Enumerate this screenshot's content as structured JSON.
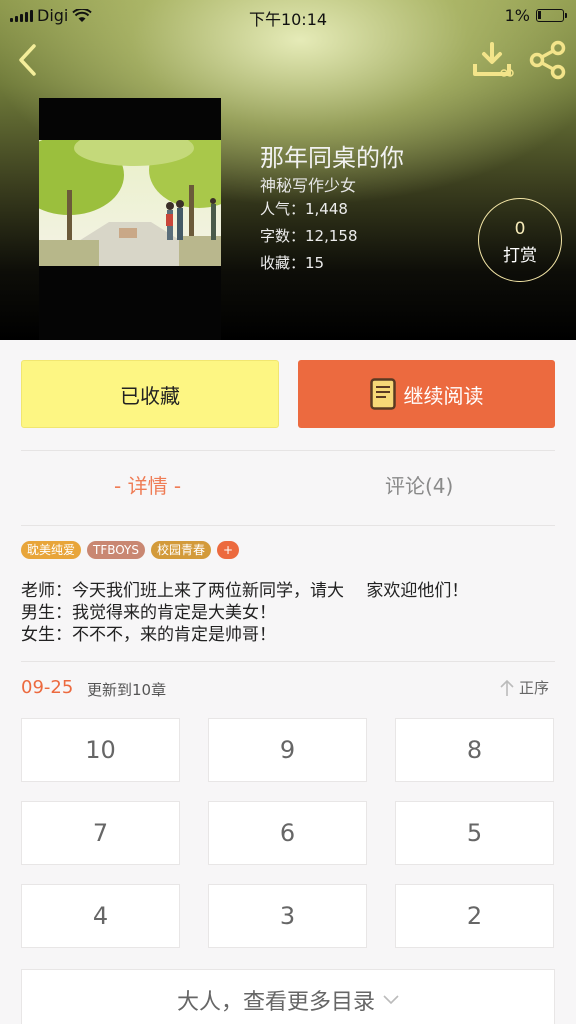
{
  "status_bar": {
    "carrier": "Digi",
    "time": "下午10:14",
    "battery": "1%"
  },
  "book": {
    "title": "那年同桌的你",
    "author": "神秘写作少女",
    "popularity": "人气：1,448",
    "word_count": "字数：12,158",
    "favorites": "收藏：15"
  },
  "tip": {
    "count": "0",
    "label": "打赏"
  },
  "actions": {
    "favorite_label": "已收藏",
    "read_label": "继续阅读"
  },
  "tabs": {
    "detail": "- 详情 -",
    "comments": "评论(4)"
  },
  "tags": [
    {
      "label": "耽美纯爱",
      "color": "#e8a53a"
    },
    {
      "label": "TFBOYS",
      "color": "#c98772"
    },
    {
      "label": "校园青春",
      "color": "#d39a3a"
    },
    {
      "label": "+",
      "color": "#ec6a3f"
    }
  ],
  "synopsis": [
    "老师：今天我们班上来了两位新同学，请大　 家欢迎他们！",
    "男生：我觉得来的肯定是大美女！",
    "女生：不不不，来的肯定是帅哥！"
  ],
  "update": {
    "date": "09-25",
    "text": "更新到10章",
    "sort_label": "正序"
  },
  "chapters": [
    "10",
    "9",
    "8",
    "7",
    "6",
    "5",
    "4",
    "3",
    "2"
  ],
  "more_label": "大人，查看更多目录",
  "colors": {
    "accent": "#ec6a3f",
    "favorite_bg": "#fdf683",
    "tip_ring": "#f3e5a6"
  }
}
